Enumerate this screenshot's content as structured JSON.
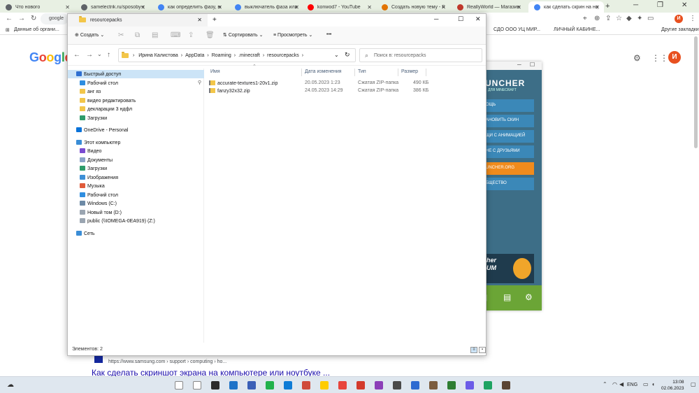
{
  "browser": {
    "tabs": [
      {
        "label": "Что нового",
        "favicon_color": "#5f6368"
      },
      {
        "label": "samelectrik.ru/sposoby-op...",
        "favicon_color": "#5f6368"
      },
      {
        "label": "как определить фазу, ноль...",
        "favicon_color": "#4285f4"
      },
      {
        "label": "выключатель фаза или но...",
        "favicon_color": "#4285f4"
      },
      {
        "label": "konwod7 - YouTube",
        "favicon_color": "#ff0000"
      },
      {
        "label": "Создать новую тему - Ro...",
        "favicon_color": "#e37400"
      },
      {
        "label": "ReallyWorld — Магазин се...",
        "favicon_color": "#c0392b"
      },
      {
        "label": "как сделать скрин на ноу...",
        "favicon_color": "#4285f4",
        "active": true
      }
    ],
    "new_tab": "+",
    "address_text": "google",
    "profile_initial": "И",
    "bookmarks": {
      "left": "Данные об органи...",
      "mid1": "СДО ООО УЦ МИР...",
      "mid2": "ЛИЧНЫЙ КАБИНЕ...",
      "right": "Другие закладки"
    }
  },
  "google_page": {
    "logo": "Google",
    "avatar_initial": "И",
    "result_url": "https://www.samsung.com › support › computing › ho...",
    "result_title": "Как сделать скриншот экрана на компьютере или ноутбуке ..."
  },
  "launcher": {
    "brand": "UNCHER",
    "subtitle": "ДЛЯ MINECRAFT",
    "buttons": [
      "ОЩЬ",
      "АНОВИТЬ СКИН",
      "ЩИ С АНИМАЦИЕЙ",
      "НЕ С ДРУЗЬЯМИ",
      "UNCHER.ORG",
      "БЩЕСТВО"
    ],
    "banner": "her\nUM"
  },
  "explorer": {
    "window_title": "resourcepacks",
    "commands": {
      "create": "Создать",
      "sort": "Сортировать",
      "view": "Просмотреть",
      "more": "•••"
    },
    "breadcrumb": [
      "Ирина Калистова",
      "AppData",
      "Roaming",
      ".minecraft",
      "resourcepacks"
    ],
    "search_placeholder": "Поиск в: resourcepacks",
    "nav": [
      {
        "label": "Быстрый доступ",
        "icon_color": "#2f6fd1",
        "indent": 1,
        "selected": true
      },
      {
        "label": "Рабочий стол",
        "icon_color": "#2f8ee0",
        "indent": 2,
        "pinned": true
      },
      {
        "label": "анг яз",
        "icon_color": "#f3c649",
        "indent": 2
      },
      {
        "label": "видео редактировать",
        "icon_color": "#f3c649",
        "indent": 2
      },
      {
        "label": "декларации 3 ндфл",
        "icon_color": "#f3c649",
        "indent": 2
      },
      {
        "label": "Загрузки",
        "icon_color": "#2e9c6a",
        "indent": 2
      },
      {
        "label": "OneDrive - Personal",
        "icon_color": "#0a73d9",
        "indent": 1,
        "gap": true
      },
      {
        "label": "Этот компьютер",
        "icon_color": "#3a8dd6",
        "indent": 1,
        "gap": true
      },
      {
        "label": "Видео",
        "icon_color": "#7a4bd1",
        "indent": 2
      },
      {
        "label": "Документы",
        "icon_color": "#8aa4c8",
        "indent": 2
      },
      {
        "label": "Загрузки",
        "icon_color": "#2e9c6a",
        "indent": 2
      },
      {
        "label": "Изображения",
        "icon_color": "#3d8fd6",
        "indent": 2
      },
      {
        "label": "Музыка",
        "icon_color": "#e05b3a",
        "indent": 2
      },
      {
        "label": "Рабочий стол",
        "icon_color": "#2f8ee0",
        "indent": 2
      },
      {
        "label": "Windows (C:)",
        "icon_color": "#6d8aa6",
        "indent": 2
      },
      {
        "label": "Новый том (D:)",
        "icon_color": "#9aa5b1",
        "indent": 2
      },
      {
        "label": "public (\\\\IOMEGA-0EA919) (Z:)",
        "icon_color": "#9aa5b1",
        "indent": 2
      },
      {
        "label": "Сеть",
        "icon_color": "#3a8dd6",
        "indent": 1,
        "gap": true
      }
    ],
    "columns": {
      "name": "Имя",
      "date": "Дата изменения",
      "type": "Тип",
      "size": "Размер"
    },
    "files": [
      {
        "name": "accurate-textures1-20v1.zip",
        "date": "20.05.2023 1:23",
        "type": "Сжатая ZIP-папка",
        "size": "490 КБ"
      },
      {
        "name": "fanzy32x32.zip",
        "date": "24.05.2023 14:29",
        "type": "Сжатая ZIP-папка",
        "size": "386 КБ"
      }
    ],
    "status": "Элементов: 2"
  },
  "taskbar": {
    "lang": "ENG",
    "time": "13:08",
    "date": "02.06.2023",
    "app_colors": [
      "#ffffff",
      "#ffffff",
      "#2b2b2b",
      "#1e73c8",
      "#3a5fb7",
      "#22b24c",
      "#0f7cd6",
      "#d04a3a",
      "#ffcc00",
      "#e8453c",
      "#d33a2c",
      "#8c3fb8",
      "#4a4a4a",
      "#2d6ad1",
      "#7b5c3e",
      "#2e7d32",
      "#6c5ce7",
      "#1ea362",
      "#5b4534"
    ]
  }
}
